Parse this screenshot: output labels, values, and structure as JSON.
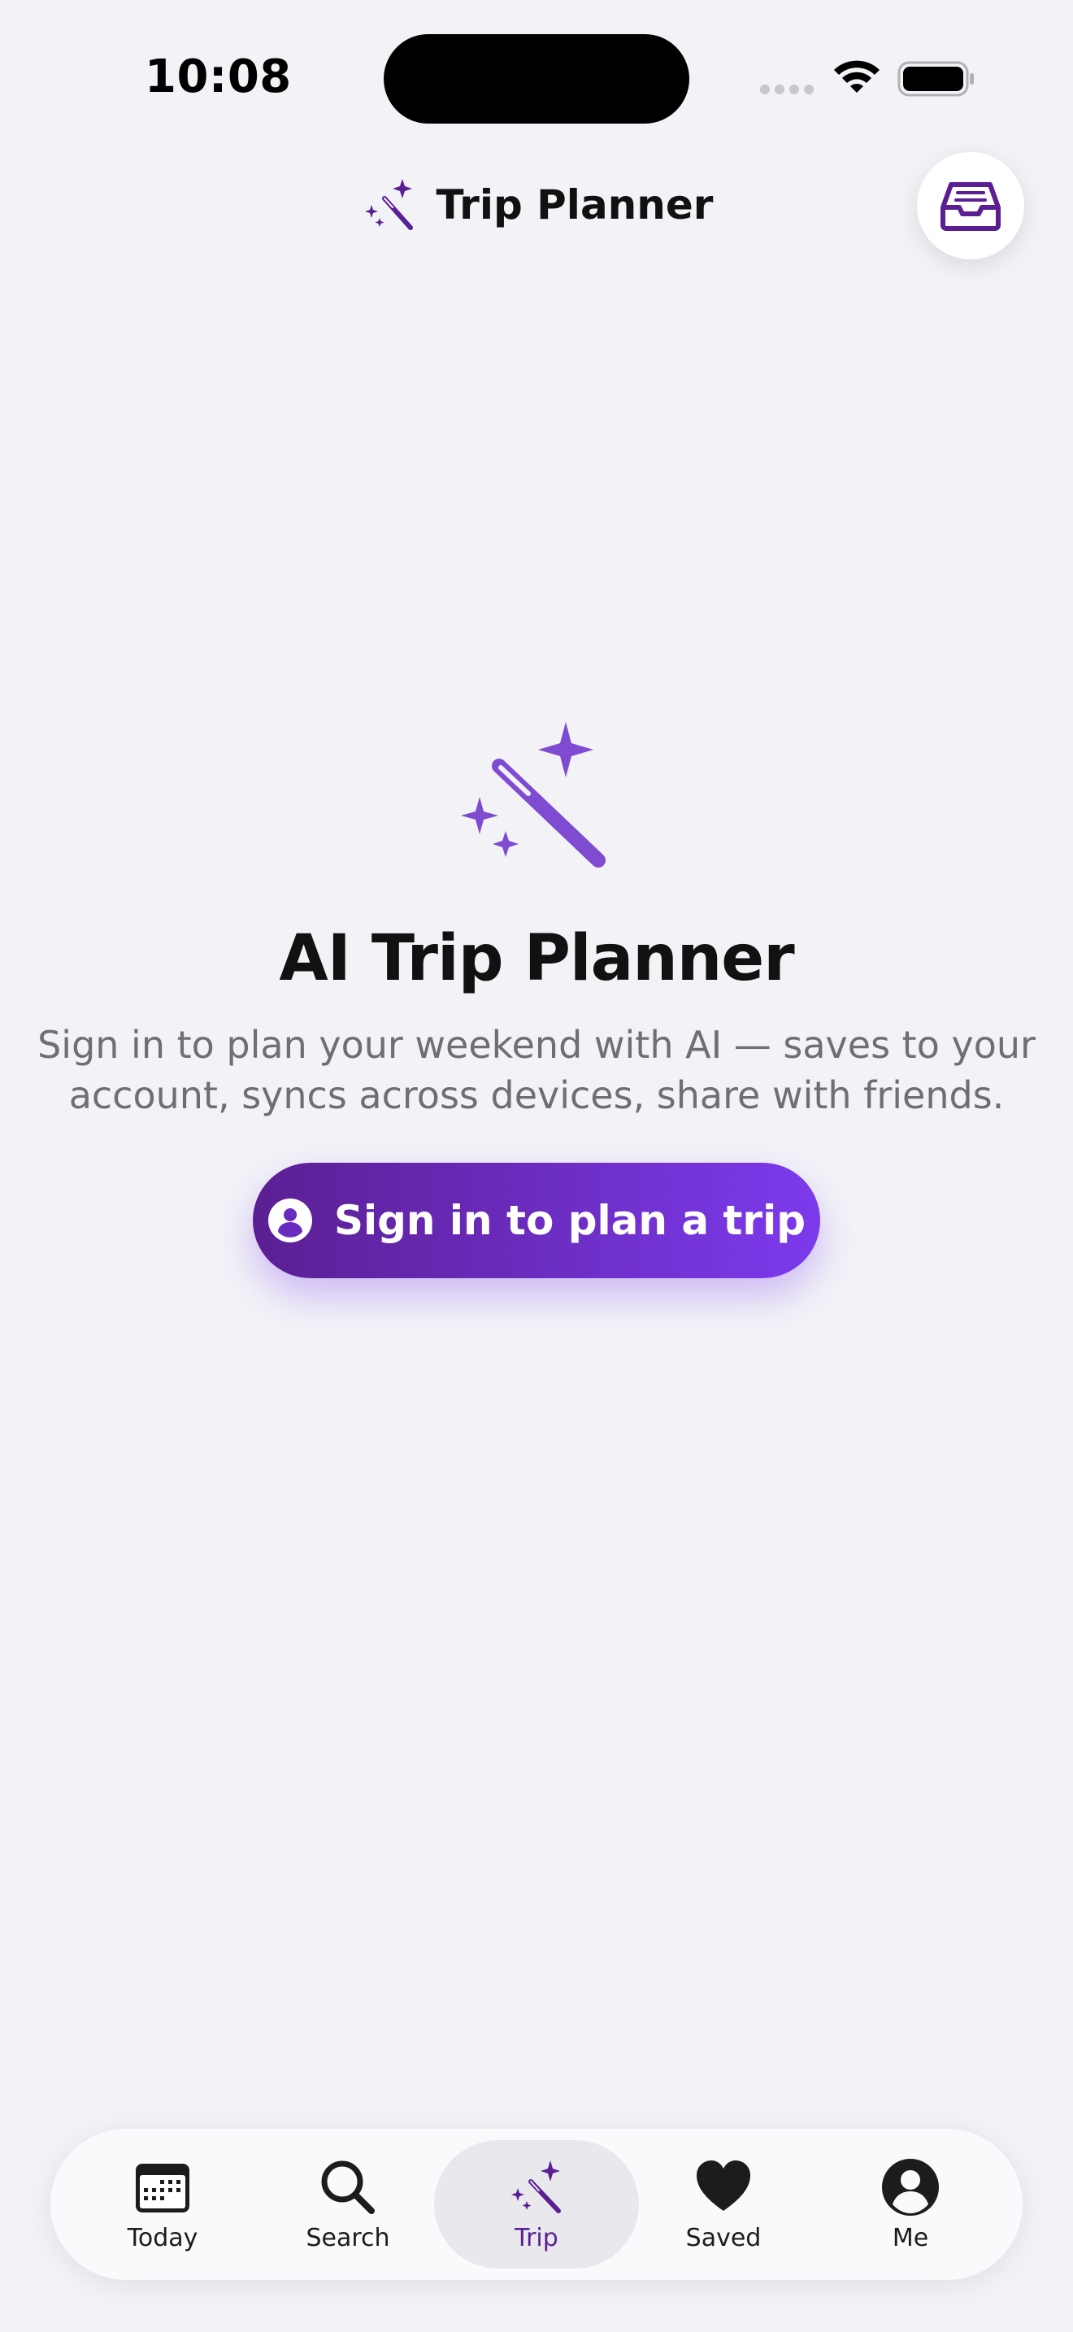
{
  "status_bar": {
    "time": "10:08",
    "icons": [
      "signal-dots-icon",
      "wifi-icon",
      "battery-icon"
    ]
  },
  "header": {
    "icon": "magic-wand-icon",
    "title": "Trip Planner",
    "inbox_icon": "inbox-tray-icon"
  },
  "main": {
    "icon": "magic-wand-icon",
    "title": "AI Trip Planner",
    "subtitle": "Sign in to plan your weekend with AI — saves to your account, syncs across devices, share with friends.",
    "sign_in_button": {
      "icon": "person-circle-icon",
      "label": "Sign in to plan a trip"
    }
  },
  "tab_bar": {
    "items": [
      {
        "label": "Today",
        "icon": "calendar-icon",
        "active": false
      },
      {
        "label": "Search",
        "icon": "search-icon",
        "active": false
      },
      {
        "label": "Trip",
        "icon": "magic-wand-icon",
        "active": true
      },
      {
        "label": "Saved",
        "icon": "heart-icon",
        "active": false
      },
      {
        "label": "Me",
        "icon": "person-circle-icon",
        "active": false
      }
    ]
  },
  "colors": {
    "accent": "#7c3aed",
    "accent_dark": "#5b1f93",
    "background": "#f2f2f7",
    "subtitle_gray": "#6e6e73"
  }
}
